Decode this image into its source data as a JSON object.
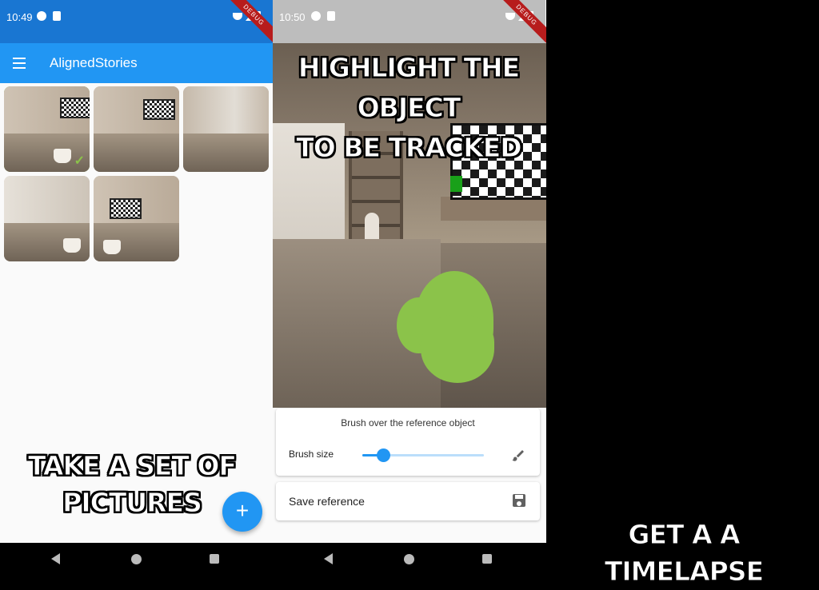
{
  "left_screen": {
    "status": {
      "time": "10:49",
      "debug": "DEBUG"
    },
    "appbar": {
      "title": "AlignedStories",
      "menu_icon": "menu-icon"
    },
    "thumbnails": [
      {
        "selected": true
      },
      {
        "selected": false
      },
      {
        "selected": false
      },
      {
        "selected": false
      },
      {
        "selected": false
      }
    ],
    "caption_line1": "TAKE A SET OF",
    "caption_line2": "PICTURES",
    "fab_label": "+"
  },
  "right_screen": {
    "status": {
      "time": "10:50",
      "debug": "DEBUG"
    },
    "caption_line1": "HIGHLIGHT THE OBJECT",
    "caption_line2": "TO BE TRACKED",
    "brush_hint": "Brush over the reference object",
    "brush_size_label": "Brush size",
    "brush_size_level": 0.17,
    "save_label": "Save reference",
    "colors": {
      "mask": "#8bc34a",
      "accent": "#2196f3"
    }
  },
  "right_caption": "GET A A TIMELAPSE"
}
